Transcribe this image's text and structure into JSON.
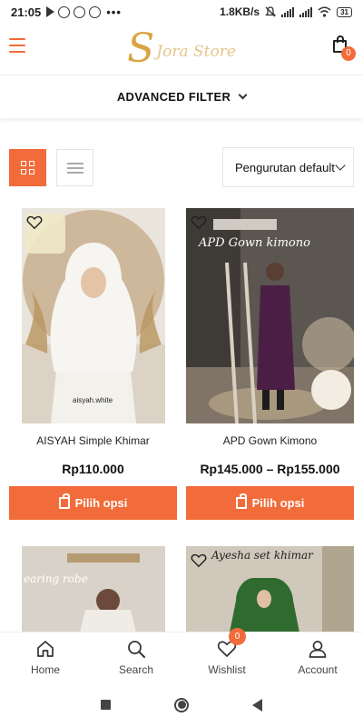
{
  "status_bar": {
    "time": "21:05",
    "speed": "1.8KB/s",
    "battery": "31"
  },
  "header": {
    "brand": "Jora Store",
    "cart_count": "0"
  },
  "filter": {
    "label": "ADVANCED FILTER"
  },
  "sort": {
    "label": "Pengurutan default"
  },
  "products": [
    {
      "title": "AISYAH Simple Khimar",
      "price": "Rp110.000",
      "image_caption": "aisyah.white",
      "button": "Pilih opsi"
    },
    {
      "title": "APD Gown Kimono",
      "price": "Rp145.000 – Rp155.000",
      "image_caption": "APD Gown kimono",
      "button": "Pilih opsi"
    },
    {
      "title": "",
      "price": "",
      "image_caption": "earing robe",
      "button": ""
    },
    {
      "title": "",
      "price": "",
      "image_caption": "Ayesha set khimar",
      "button": ""
    }
  ],
  "bottom_nav": {
    "items": [
      {
        "label": "Home",
        "icon": "home-icon"
      },
      {
        "label": "Search",
        "icon": "search-icon"
      },
      {
        "label": "Wishlist",
        "icon": "heart-icon",
        "badge": "0"
      },
      {
        "label": "Account",
        "icon": "user-icon"
      }
    ]
  },
  "colors": {
    "accent": "#f26b3a",
    "logo_gold": "#d9a441"
  }
}
